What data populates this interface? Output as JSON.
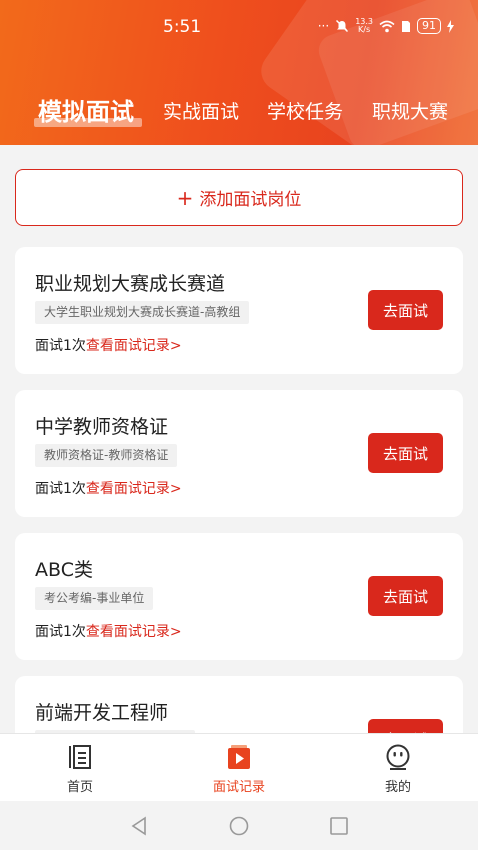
{
  "status_bar": {
    "time": "5:51",
    "dots": "···",
    "net_speed_value": "13.3",
    "net_speed_unit": "K/s",
    "battery": "91"
  },
  "tabs": [
    {
      "label": "模拟面试",
      "active": true
    },
    {
      "label": "实战面试",
      "active": false
    },
    {
      "label": "学校任务",
      "active": false
    },
    {
      "label": "职规大赛",
      "active": false
    }
  ],
  "add_position": {
    "icon": "+",
    "label": "添加面试岗位"
  },
  "cards": [
    {
      "title": "职业规划大赛成长赛道",
      "tag": "大学生职业规划大赛成长赛道-高教组",
      "count": "面试1次",
      "link": "查看面试记录>",
      "button": "去面试"
    },
    {
      "title": "中学教师资格证",
      "tag": "教师资格证-教师资格证",
      "count": "面试1次",
      "link": "查看面试记录>",
      "button": "去面试"
    },
    {
      "title": "ABC类",
      "tag": "考公考编-事业单位",
      "count": "面试1次",
      "link": "查看面试记录>",
      "button": "去面试"
    },
    {
      "title": "前端开发工程师",
      "tag": "",
      "count": "",
      "link": "",
      "button": "去面试"
    }
  ],
  "bottom_nav": [
    {
      "label": "首页",
      "icon": "home-list-icon",
      "active": false
    },
    {
      "label": "面试记录",
      "icon": "record-play-icon",
      "active": true
    },
    {
      "label": "我的",
      "icon": "smiley-profile-icon",
      "active": false
    }
  ],
  "colors": {
    "accent": "#d9281c",
    "header_orange": "#ef4f1d",
    "active_nav": "#e8431f"
  }
}
